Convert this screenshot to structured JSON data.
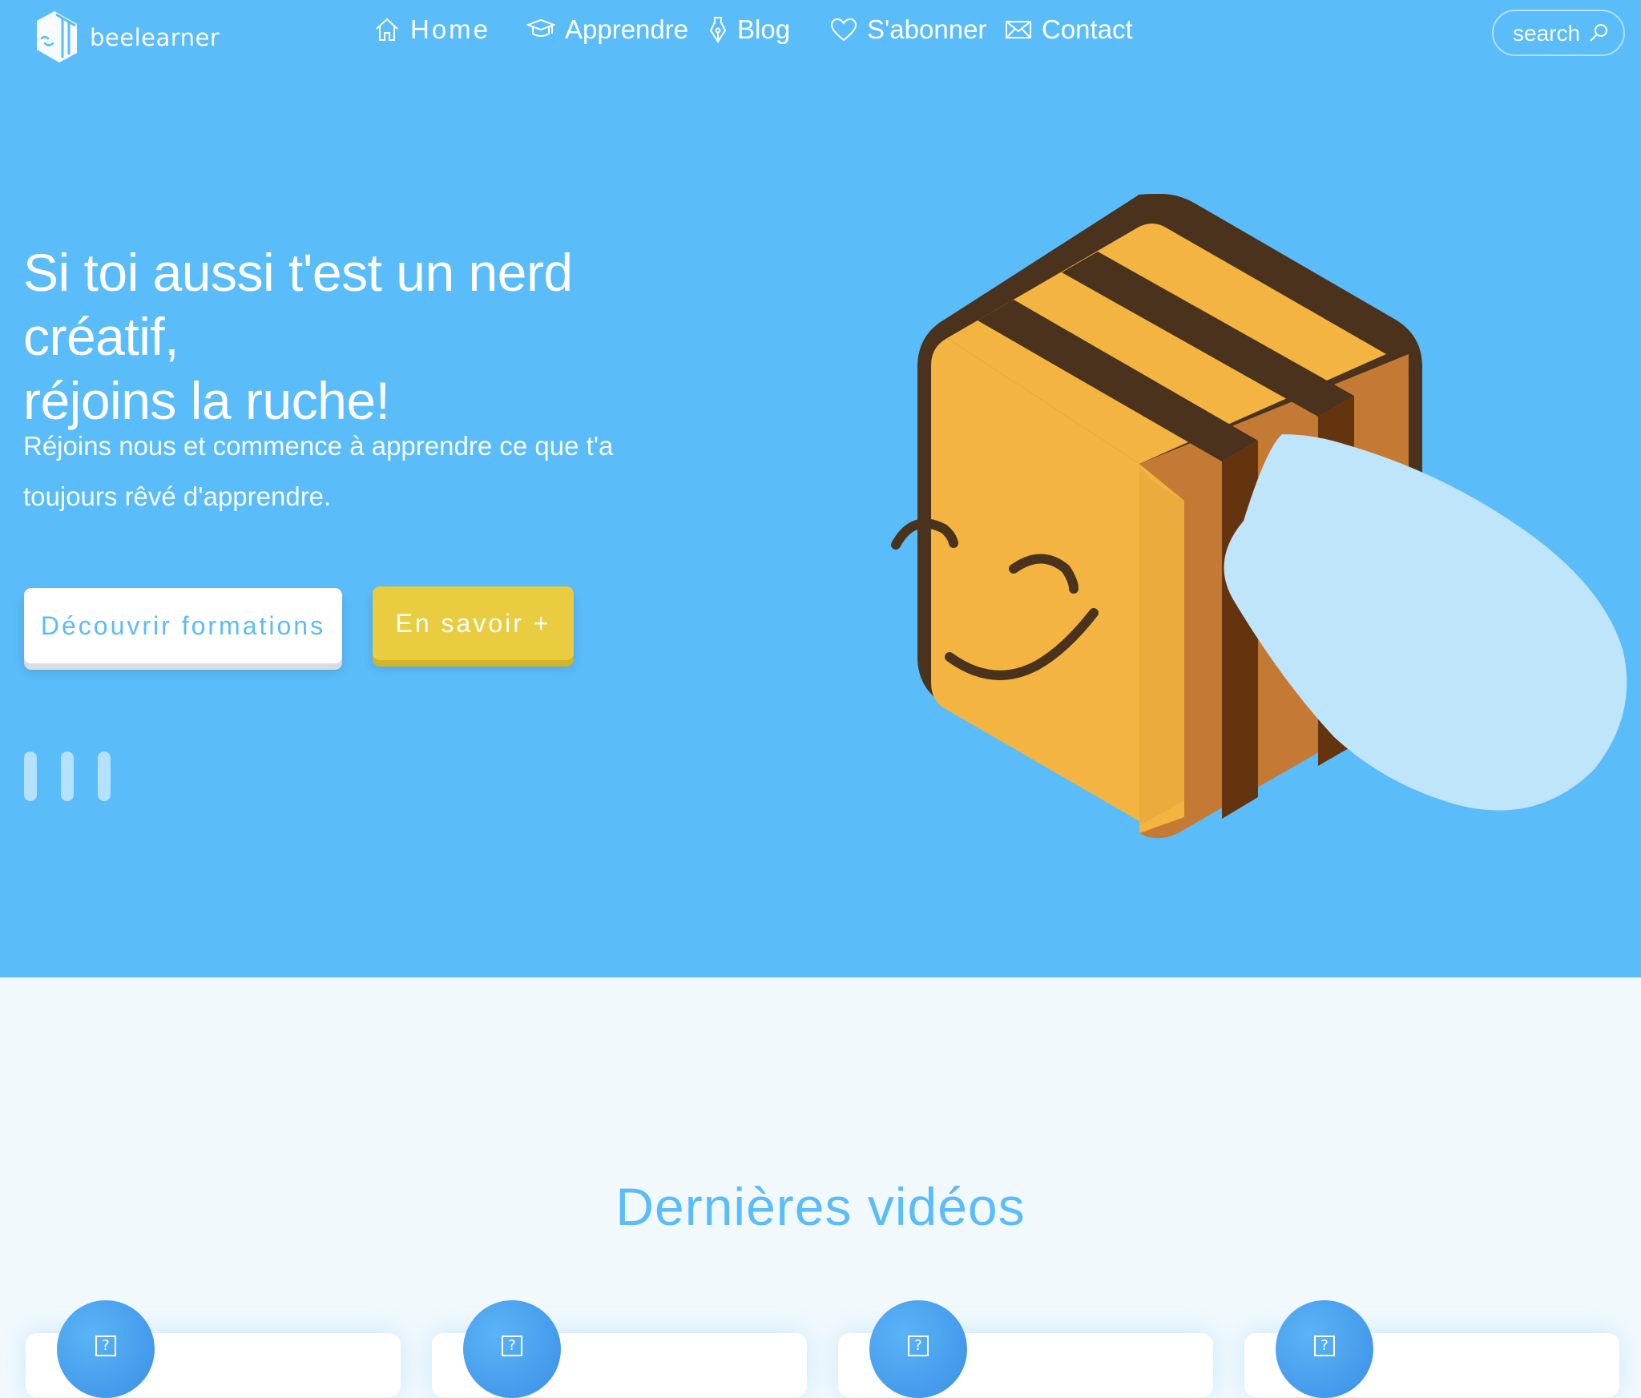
{
  "brand": {
    "name": "beelearner"
  },
  "nav": {
    "items": [
      {
        "label": "Home",
        "icon": "home-icon",
        "active": true
      },
      {
        "label": "Apprendre",
        "icon": "graduation-cap-icon",
        "active": false
      },
      {
        "label": "Blog",
        "icon": "pen-nib-icon",
        "active": false
      },
      {
        "label": "S'abonner",
        "icon": "heart-icon",
        "active": false
      },
      {
        "label": "Contact",
        "icon": "envelope-icon",
        "active": false
      }
    ]
  },
  "search": {
    "placeholder": "search",
    "icon": "search-icon"
  },
  "hero": {
    "title_line1": "Si toi aussi t'est un nerd créatif,",
    "title_line2": "réjoins la ruche!",
    "subtitle": "Réjoins nous et commence à apprendre ce que t'a toujours rêvé d'apprendre.",
    "primary_button": "Découvrir formations",
    "secondary_button": "En savoir +",
    "slide_count": 3
  },
  "videos": {
    "title": "Dernières vidéos",
    "card_count": 4
  },
  "colors": {
    "hero_bg": "#5abcf9",
    "accent_yellow": "#e9cc3f",
    "page_bg": "#f1f9fd",
    "bee_body": "#f3b441",
    "bee_shadow": "#c47934",
    "bee_stripe": "#4a321c",
    "wing": "#bfe5fb"
  }
}
